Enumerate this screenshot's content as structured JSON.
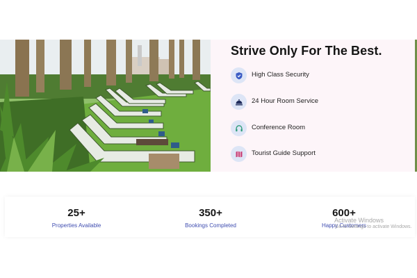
{
  "features": {
    "title": "Strive Only For The Best.",
    "items": [
      {
        "label": "High Class Security",
        "icon": "shield-icon"
      },
      {
        "label": "24 Hour Room Service",
        "icon": "room-service-icon"
      },
      {
        "label": "Conference Room",
        "icon": "headset-icon"
      },
      {
        "label": "Tourist Guide Support",
        "icon": "map-icon"
      }
    ],
    "icon_color": "#3b5cc4",
    "icon_bg": "#dde5f6"
  },
  "stats": [
    {
      "value": "25+",
      "caption": "Properties Available"
    },
    {
      "value": "350+",
      "caption": "Bookings Completed"
    },
    {
      "value": "600+",
      "caption": "Happy Customers"
    }
  ],
  "watermark": {
    "line1": "Activate Windows",
    "line2": "Go to Settings to activate Windows."
  },
  "colors": {
    "accent": "#3f4db0",
    "background": "#fdf5f9"
  }
}
